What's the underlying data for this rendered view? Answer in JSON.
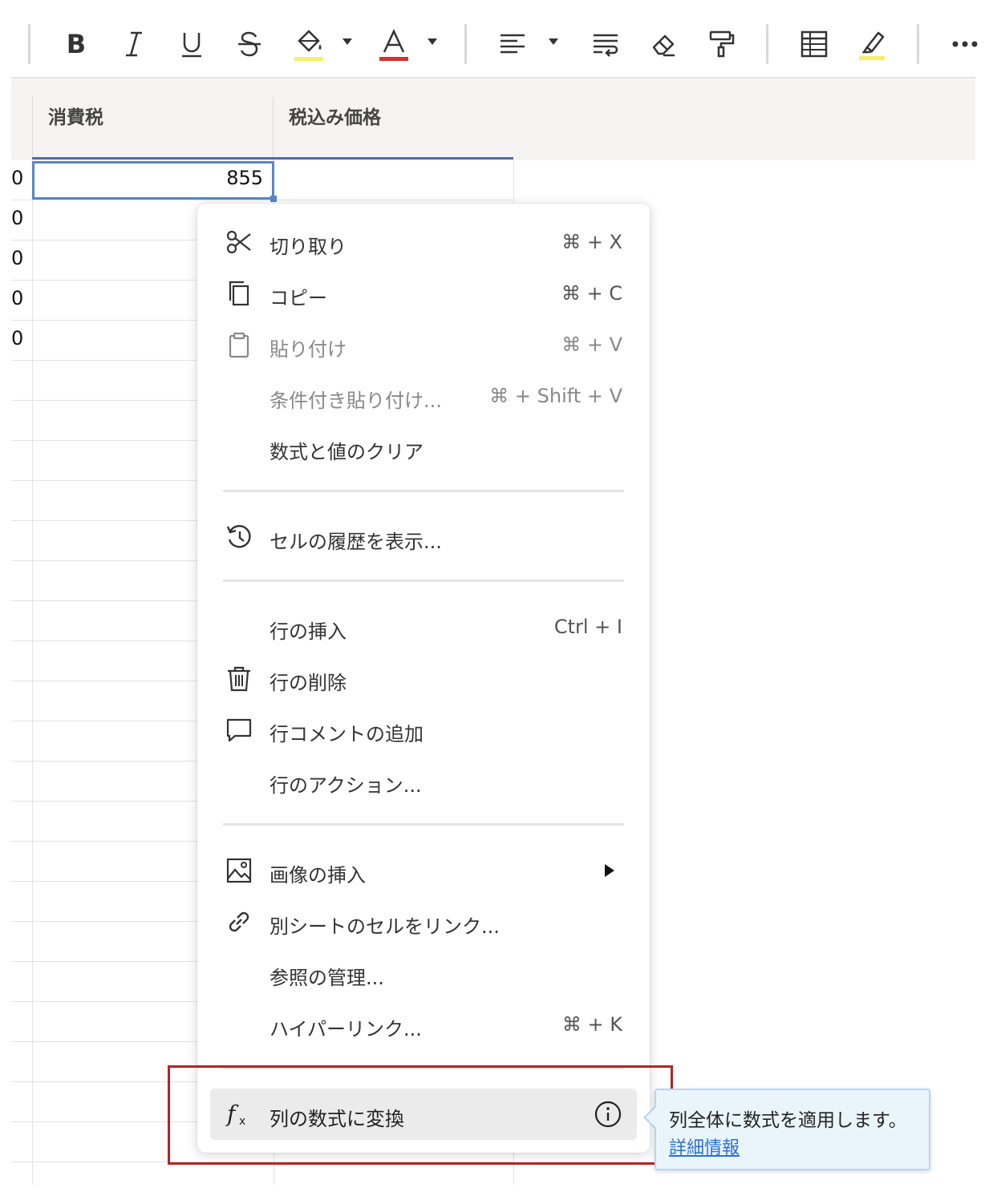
{
  "toolbar": {
    "buttons": [
      {
        "name": "bold-icon"
      },
      {
        "name": "italic-icon"
      },
      {
        "name": "underline-icon"
      },
      {
        "name": "strikethrough-icon"
      },
      {
        "name": "fill-color-icon",
        "swatch": "#f7ef6b"
      },
      {
        "name": "text-color-icon",
        "swatch": "#d8312a"
      },
      {
        "name": "align-left-icon"
      },
      {
        "name": "wrap-text-icon"
      },
      {
        "name": "eraser-icon"
      },
      {
        "name": "format-painter-icon"
      },
      {
        "name": "grid-icon"
      },
      {
        "name": "highlight-icon",
        "swatch": "#f7ef6b"
      },
      {
        "name": "more-icon"
      }
    ]
  },
  "sheet": {
    "columns": [
      {
        "label": "消費税"
      },
      {
        "label": "税込み価格"
      }
    ],
    "row_stub_values": [
      "0",
      "0",
      "0",
      "0",
      "0"
    ],
    "active_cell_value": "855",
    "accent_color": "#5b86c8"
  },
  "context_menu": {
    "items": [
      {
        "id": "cut",
        "label": "切り取り",
        "shortcut": "⌘ + X",
        "icon": "scissors-icon",
        "disabled": false
      },
      {
        "id": "copy",
        "label": "コピー",
        "shortcut": "⌘ + C",
        "icon": "copy-icon",
        "disabled": false
      },
      {
        "id": "paste",
        "label": "貼り付け",
        "shortcut": "⌘ + V",
        "icon": "clipboard-icon",
        "disabled": true
      },
      {
        "id": "paste-special",
        "label": "条件付き貼り付け...",
        "shortcut": "⌘ + Shift + V",
        "icon": "",
        "disabled": true
      },
      {
        "id": "clear",
        "label": "数式と値のクリア",
        "shortcut": "",
        "icon": "",
        "disabled": false
      },
      {
        "id": "history",
        "label": "セルの履歴を表示...",
        "shortcut": "",
        "icon": "history-icon",
        "disabled": false
      },
      {
        "id": "insert-row",
        "label": "行の挿入",
        "shortcut": "Ctrl + I",
        "icon": "",
        "disabled": false
      },
      {
        "id": "delete-row",
        "label": "行の削除",
        "shortcut": "",
        "icon": "trash-icon",
        "disabled": false
      },
      {
        "id": "add-comment",
        "label": "行コメントの追加",
        "shortcut": "",
        "icon": "comment-icon",
        "disabled": false
      },
      {
        "id": "row-actions",
        "label": "行のアクション...",
        "shortcut": "",
        "icon": "",
        "disabled": false
      },
      {
        "id": "insert-image",
        "label": "画像の挿入",
        "shortcut": "",
        "icon": "image-icon",
        "disabled": false
      },
      {
        "id": "link-cell",
        "label": "別シートのセルをリンク...",
        "shortcut": "",
        "icon": "link-icon",
        "disabled": false
      },
      {
        "id": "manage-refs",
        "label": "参照の管理...",
        "shortcut": "",
        "icon": "",
        "disabled": false
      },
      {
        "id": "hyperlink",
        "label": "ハイパーリンク...",
        "shortcut": "⌘ + K",
        "icon": "",
        "disabled": false
      },
      {
        "id": "convert-formula",
        "label": "列の数式に変換",
        "shortcut": "",
        "icon": "function-icon",
        "disabled": false
      }
    ]
  },
  "tooltip": {
    "text": "列全体に数式を適用します。",
    "link": "詳細情報",
    "background": "#eaf4fb"
  },
  "annotation": {
    "color": "#b42424"
  }
}
